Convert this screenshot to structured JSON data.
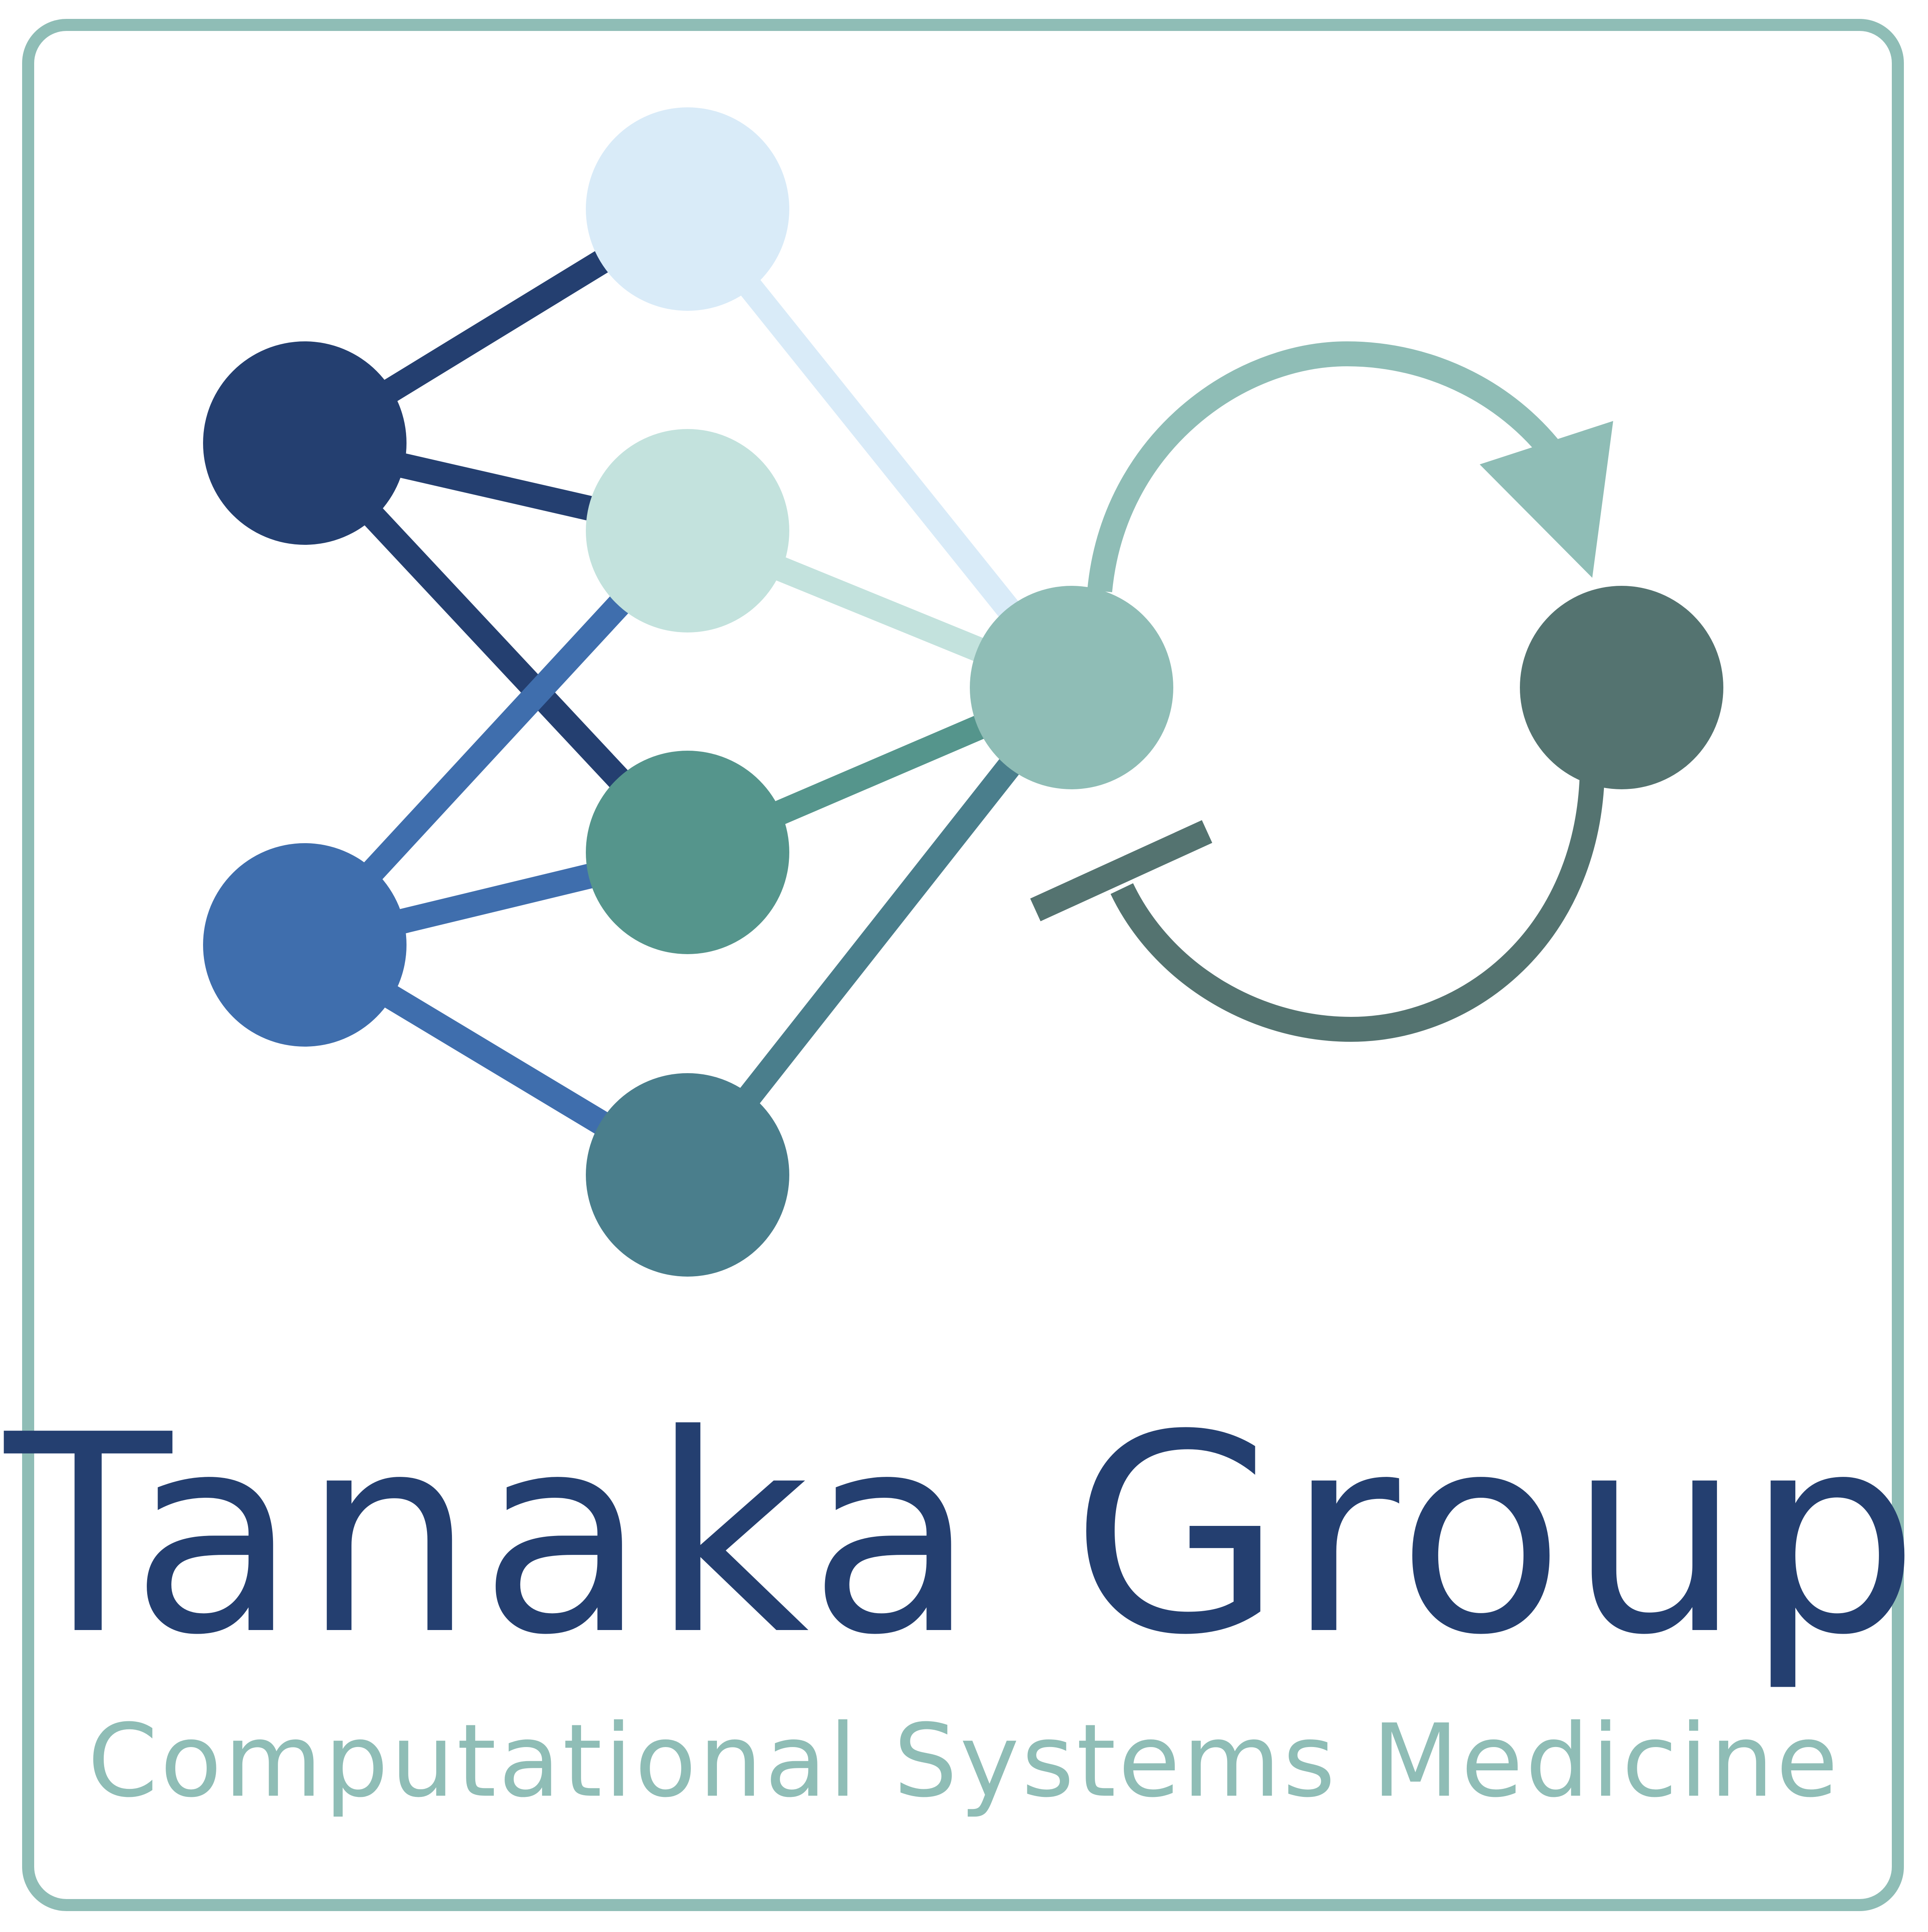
{
  "logo": {
    "title": "Tanaka Group",
    "subtitle": "Computational Systems Medicine"
  },
  "colors": {
    "frame": "#8fbdb6",
    "title": "#243f70",
    "subtitle": "#8fbdb6",
    "node_navy": "#243f70",
    "node_blue": "#3f6ead",
    "node_pale_blue": "#d9ebf8",
    "node_pale_teal": "#c3e2dd",
    "node_teal": "#55958c",
    "node_steel": "#4a7e8c",
    "node_hub": "#8fbdb6",
    "node_target": "#547370",
    "arrow_activation": "#8fbdb6",
    "arrow_inhibition": "#547370"
  }
}
